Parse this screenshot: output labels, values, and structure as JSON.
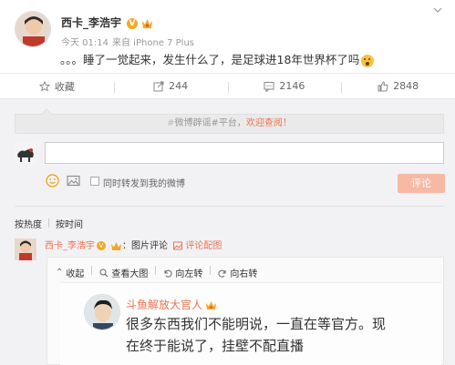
{
  "post": {
    "author": "西卡_李浩宇",
    "time": "今天 01:14",
    "source": "来自 iPhone 7 Plus",
    "text": "。。。睡了一觉起来，发生什么了，是足球进18年世界杯了吗"
  },
  "actions": {
    "favorite": "收藏",
    "repost_count": "244",
    "comment_count": "2146",
    "like_count": "2848"
  },
  "notice": {
    "hash": "#",
    "text": "微博辟谣#平台，",
    "link": "欢迎查阅！"
  },
  "composer": {
    "placeholder": "",
    "forward_label": "同时转发到我的微博",
    "submit_label": "评论"
  },
  "sort": {
    "hot": "按热度",
    "time": "按时间"
  },
  "comment": {
    "author": "西卡_李浩宇",
    "text": "：图片评论",
    "link": "评论配图"
  },
  "viewer": {
    "collapse": "收起",
    "view_large": "查看大图",
    "rotate_left": "向左转",
    "rotate_right": "向右转"
  },
  "image": {
    "name": "斗鱼解放大官人",
    "line1": "很多东西我们不能明说，一直在等官方。现",
    "line2": "在终于能说了，挂壁不配直播"
  },
  "colors": {
    "accent": "#eb7350",
    "badge": "#f5a623",
    "submit_bg": "#f7b9a4",
    "panel_bg": "#f2f2f5"
  }
}
